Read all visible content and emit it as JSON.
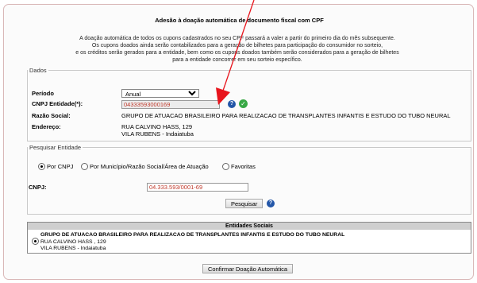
{
  "title": "Adesão à doação automática de documento fiscal com CPF",
  "notice_lines": [
    "A doação automática de todos os cupons cadastrados no seu CPF passará a valer a partir do primeiro dia do mês subsequente.",
    "Os cupons doados ainda serão contabilizados para a geração de bilhetes para participação do consumidor no sorteio,",
    "e os créditos serão gerados para a entidade, bem como os cupons doados também serão considerados para a geração de bilhetes",
    "para a entidade concorrer em seu sorteio específico."
  ],
  "dados": {
    "legend": "Dados",
    "periodo_label": "Período",
    "periodo_value": "Anual",
    "cnpj_label": "CNPJ Entidade(*):",
    "cnpj_value": "04333593000169",
    "razao_label": "Razão Social:",
    "razao_value": "GRUPO DE ATUACAO BRASILEIRO PARA REALIZACAO DE TRANSPLANTES INFANTIS E ESTUDO DO TUBO NEURAL",
    "endereco_label": "Endereço:",
    "endereco_line1": "RUA CALVINO HASS, 129",
    "endereco_line2": "VILA RUBENS - Indaiatuba"
  },
  "search": {
    "legend": "Pesquisar Entidade",
    "radio_cnpj": "Por CNPJ",
    "radio_municipio": "Por Município/Razão Social/Área de Atuação",
    "radio_favoritas": "Favoritas",
    "cnpj_label": "CNPJ:",
    "cnpj_value": "04.333.593/0001-69",
    "search_button": "Pesquisar"
  },
  "results": {
    "header": "Entidades Sociais",
    "name": "GRUPO DE ATUACAO BRASILEIRO PARA REALIZACAO DE TRANSPLANTES INFANTIS E ESTUDO DO TUBO NEURAL",
    "address1": "RUA CALVINO HASS , 129",
    "address2": "VILA RUBENS  -  Indaiatuba"
  },
  "confirm_button": "Confirmar Doação Automática",
  "icons": {
    "help": "question-icon",
    "ok": "check-icon"
  },
  "colors": {
    "cnpj_text": "#c0392b",
    "annotation_arrow": "#e8141c",
    "help": "#2356a8",
    "ok": "#38a845"
  }
}
